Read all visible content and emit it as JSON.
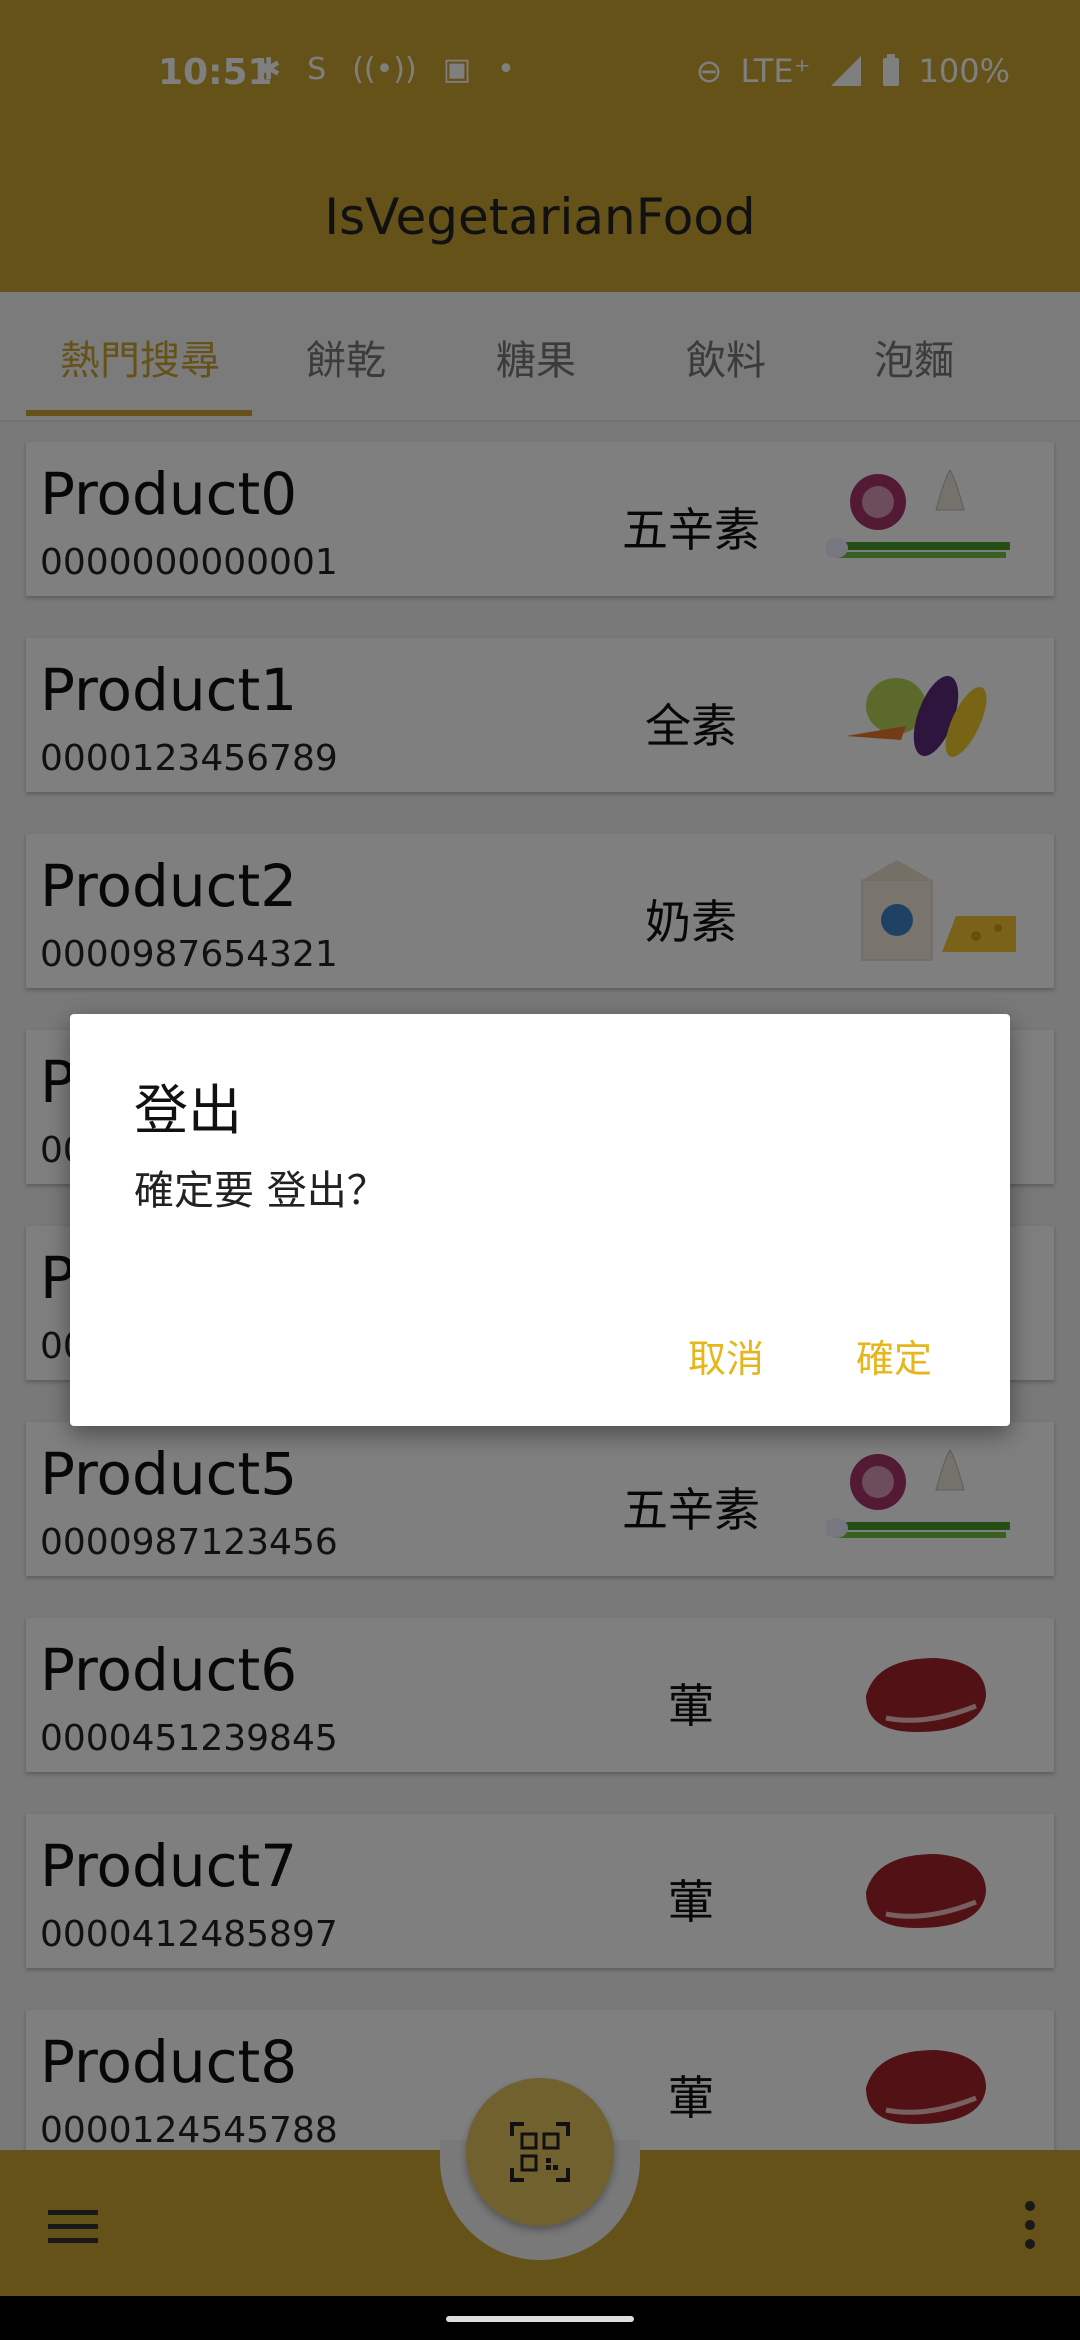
{
  "status": {
    "time": "10:51",
    "network": "LTE⁺",
    "battery": "100%"
  },
  "app": {
    "title": "IsVegetarianFood"
  },
  "tabs": [
    "熱門搜尋",
    "餅乾",
    "糖果",
    "飲料",
    "泡麵"
  ],
  "products": [
    {
      "name": "Product0",
      "code": "0000000000001",
      "type": "五辛素",
      "icon": "onion-garlic-scallion-icon"
    },
    {
      "name": "Product1",
      "code": "0000123456789",
      "type": "全素",
      "icon": "vegetables-icon"
    },
    {
      "name": "Product2",
      "code": "0000987654321",
      "type": "奶素",
      "icon": "milk-cheese-icon"
    },
    {
      "name": "P",
      "code": "00",
      "type": "",
      "icon": ""
    },
    {
      "name": "P",
      "code": "00",
      "type": "",
      "icon": ""
    },
    {
      "name": "Product5",
      "code": "0000987123456",
      "type": "五辛素",
      "icon": "onion-garlic-scallion-icon"
    },
    {
      "name": "Product6",
      "code": "0000451239845",
      "type": "葷",
      "icon": "meat-icon"
    },
    {
      "name": "Product7",
      "code": "0000412485897",
      "type": "葷",
      "icon": "meat-icon"
    },
    {
      "name": "Product8",
      "code": "0000124545788",
      "type": "葷",
      "icon": "meat-icon"
    }
  ],
  "dialog": {
    "title": "登出",
    "message": "確定要 登出？",
    "cancel": "取消",
    "confirm": "確定"
  },
  "colors": {
    "accent": "#c9a531",
    "button": "#e7b61b"
  }
}
